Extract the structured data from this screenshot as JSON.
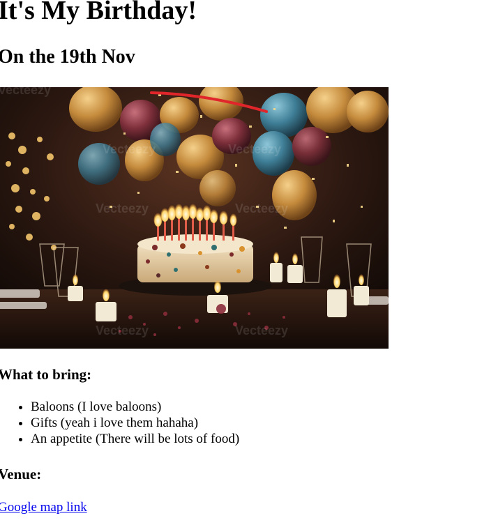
{
  "page": {
    "title": "It's My Birthday!",
    "subtitle": "On the 19th Nov"
  },
  "hero_image": {
    "alt": "Birthday cake with candles and balloons",
    "watermark": "Vecteezy"
  },
  "bring": {
    "heading": "What to bring:",
    "items": [
      "Baloons (I love baloons)",
      "Gifts (yeah i love them hahaha)",
      "An appetite (There will be lots of food)"
    ]
  },
  "venue": {
    "heading": "Venue:",
    "link_label": "Google map link"
  },
  "colors": {
    "link": "#0000ee",
    "text": "#000000"
  }
}
